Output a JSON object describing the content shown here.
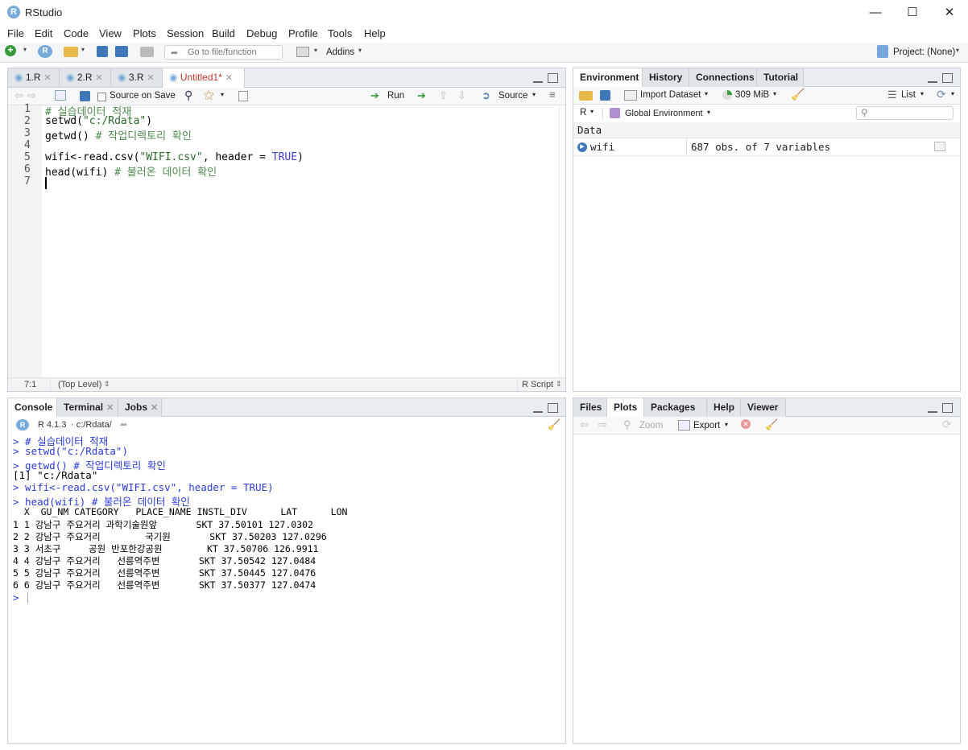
{
  "window": {
    "title": "RStudio",
    "icon_letter": "R",
    "min": "—",
    "max": "☐",
    "close": "✕"
  },
  "menu": [
    "File",
    "Edit",
    "Code",
    "View",
    "Plots",
    "Session",
    "Build",
    "Debug",
    "Profile",
    "Tools",
    "Help"
  ],
  "toolbar": {
    "goto_placeholder": "Go to file/function",
    "addins": "Addins",
    "project": "Project: (None)"
  },
  "editor": {
    "tabs": [
      {
        "label": "1.R"
      },
      {
        "label": "2.R"
      },
      {
        "label": "3.R"
      },
      {
        "label": "Untitled1*"
      }
    ],
    "source_on_save": "Source on Save",
    "run": "Run",
    "source": "Source",
    "line_numbers": [
      "1",
      "2",
      "3",
      "4",
      "5",
      "6",
      "7"
    ],
    "lines": [
      {
        "a": "",
        "b": "# 실습데이터 적재",
        "c": ""
      },
      {
        "a": "setwd(",
        "b": "\"c:/Rdata\"",
        "c": ")"
      },
      {
        "a": "getwd() ",
        "b": "# 작업디렉토리 확인",
        "c": ""
      },
      {
        "a": "",
        "b": "",
        "c": ""
      },
      {
        "a": "wifi<-read.csv(",
        "b": "\"WIFI.csv\"",
        "c": ", header = ",
        "d": "TRUE",
        "e": ")"
      },
      {
        "a": "head(wifi) ",
        "b": "# 불러온 데이터 확인",
        "c": ""
      }
    ],
    "status_pos": "7:1",
    "status_scope": "(Top Level)",
    "status_lang": "R Script"
  },
  "console": {
    "tabs": [
      "Console",
      "Terminal",
      "Jobs"
    ],
    "version": "R 4.1.3",
    "path": "· c:/Rdata/",
    "cmds": [
      "> # 실습데이터 적재",
      "> setwd(\"c:/Rdata\")",
      "> getwd() # 작업디렉토리 확인"
    ],
    "out1": "[1] \"c:/Rdata\"",
    "cmds2": [
      "> wifi<-read.csv(\"WIFI.csv\", header = TRUE)",
      "> head(wifi) # 불러온 데이터 확인"
    ],
    "table_header": "  X  GU_NM CATEGORY   PLACE_NAME INSTL_DIV      LAT      LON",
    "table_rows": [
      "1 1 강남구 주요거리 과학기술원앞       SKT 37.50101 127.0302",
      "2 2 강남구 주요거리        국기원       SKT 37.50203 127.0296",
      "3 3 서초구     공원 반포한강공원        KT 37.50706 126.9911",
      "4 4 강남구 주요거리   선릉역주변       SKT 37.50542 127.0484",
      "5 5 강남구 주요거리   선릉역주변       SKT 37.50445 127.0476",
      "6 6 강남구 주요거리   선릉역주변       SKT 37.50377 127.0474"
    ],
    "prompt": ">"
  },
  "environment": {
    "tabs": [
      "Environment",
      "History",
      "Connections",
      "Tutorial"
    ],
    "import": "Import Dataset",
    "memory": "309 MiB",
    "view": "List",
    "lang": "R",
    "scope": "Global Environment",
    "section": "Data",
    "rows": [
      {
        "name": "wifi",
        "value": "687 obs. of 7 variables"
      }
    ]
  },
  "files": {
    "tabs": [
      "Files",
      "Plots",
      "Packages",
      "Help",
      "Viewer"
    ],
    "zoom": "Zoom",
    "export": "Export"
  }
}
